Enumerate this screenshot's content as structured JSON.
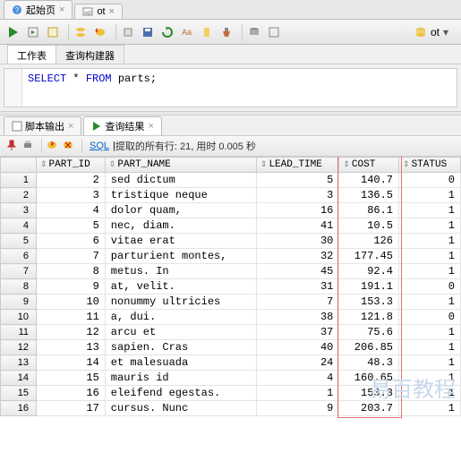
{
  "topTabs": [
    {
      "label": "起始页",
      "icon": "help"
    },
    {
      "label": "ot",
      "icon": "sql"
    }
  ],
  "connection": {
    "label": "ot"
  },
  "subTabs": {
    "worksheet": "工作表",
    "queryBuilder": "查询构建器"
  },
  "sql": {
    "kw1": "SELECT",
    "star": " * ",
    "kw2": "FROM",
    "rest": " parts;"
  },
  "outputTabs": {
    "script": "脚本输出",
    "result": "查询结果"
  },
  "resultBar": {
    "sqlLink": "SQL",
    "sep": " | ",
    "status": "提取的所有行: 21, 用时 0.005 秒"
  },
  "columns": {
    "c0": "",
    "c1": "PART_ID",
    "c2": "PART_NAME",
    "c3": "LEAD_TIME",
    "c4": "COST",
    "c5": "STATUS"
  },
  "rows": [
    {
      "n": "1",
      "id": "2",
      "name": "sed dictum",
      "lt": "5",
      "cost": "140.7",
      "st": "0"
    },
    {
      "n": "2",
      "id": "3",
      "name": "tristique neque",
      "lt": "3",
      "cost": "136.5",
      "st": "1"
    },
    {
      "n": "3",
      "id": "4",
      "name": "dolor quam,",
      "lt": "16",
      "cost": "86.1",
      "st": "1"
    },
    {
      "n": "4",
      "id": "5",
      "name": "nec, diam.",
      "lt": "41",
      "cost": "10.5",
      "st": "1"
    },
    {
      "n": "5",
      "id": "6",
      "name": "vitae erat",
      "lt": "30",
      "cost": "126",
      "st": "1"
    },
    {
      "n": "6",
      "id": "7",
      "name": "parturient montes,",
      "lt": "32",
      "cost": "177.45",
      "st": "1"
    },
    {
      "n": "7",
      "id": "8",
      "name": "metus. In",
      "lt": "45",
      "cost": "92.4",
      "st": "1"
    },
    {
      "n": "8",
      "id": "9",
      "name": "at, velit.",
      "lt": "31",
      "cost": "191.1",
      "st": "0"
    },
    {
      "n": "9",
      "id": "10",
      "name": "nonummy ultricies",
      "lt": "7",
      "cost": "153.3",
      "st": "1"
    },
    {
      "n": "10",
      "id": "11",
      "name": "a, dui.",
      "lt": "38",
      "cost": "121.8",
      "st": "0"
    },
    {
      "n": "11",
      "id": "12",
      "name": "arcu et",
      "lt": "37",
      "cost": "75.6",
      "st": "1"
    },
    {
      "n": "12",
      "id": "13",
      "name": "sapien. Cras",
      "lt": "40",
      "cost": "206.85",
      "st": "1"
    },
    {
      "n": "13",
      "id": "14",
      "name": "et malesuada",
      "lt": "24",
      "cost": "48.3",
      "st": "1"
    },
    {
      "n": "14",
      "id": "15",
      "name": "mauris id",
      "lt": "4",
      "cost": "160.65",
      "st": "1"
    },
    {
      "n": "15",
      "id": "16",
      "name": "eleifend egestas.",
      "lt": "1",
      "cost": "153.3",
      "st": "1"
    },
    {
      "n": "16",
      "id": "17",
      "name": "cursus. Nunc",
      "lt": "9",
      "cost": "203.7",
      "st": "1"
    }
  ],
  "watermark": "易百教程"
}
